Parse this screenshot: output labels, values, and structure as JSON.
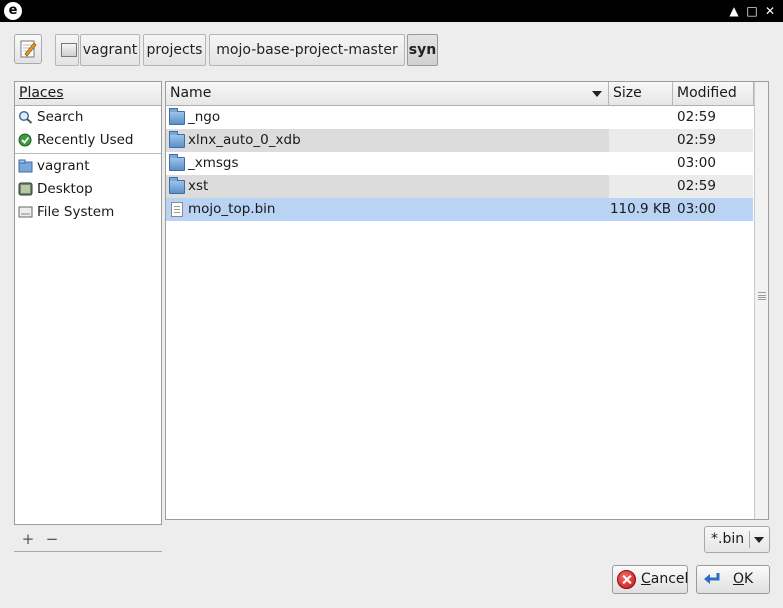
{
  "titlebar": {
    "app_icon": "e",
    "controls": {
      "up": "▲",
      "maximize": "□",
      "close": "✕"
    }
  },
  "path": {
    "segments": [
      "vagrant",
      "projects",
      "mojo-base-project-master",
      "syn"
    ]
  },
  "places": {
    "header": "Places",
    "items": [
      {
        "label": "Search",
        "icon": "search-icon"
      },
      {
        "label": "Recently Used",
        "icon": "recent-icon"
      },
      {
        "label": "vagrant",
        "icon": "home-folder-icon"
      },
      {
        "label": "Desktop",
        "icon": "desktop-icon"
      },
      {
        "label": "File System",
        "icon": "drive-icon"
      }
    ],
    "add": "+",
    "remove": "−"
  },
  "files": {
    "columns": {
      "name": "Name",
      "size": "Size",
      "modified": "Modified"
    },
    "rows": [
      {
        "name": "_ngo",
        "size": "",
        "modified": "02:59",
        "type": "folder"
      },
      {
        "name": "xlnx_auto_0_xdb",
        "size": "",
        "modified": "02:59",
        "type": "folder"
      },
      {
        "name": "_xmsgs",
        "size": "",
        "modified": "03:00",
        "type": "folder"
      },
      {
        "name": "xst",
        "size": "",
        "modified": "02:59",
        "type": "folder"
      },
      {
        "name": "mojo_top.bin",
        "size": "110.9 KB",
        "modified": "03:00",
        "type": "file"
      }
    ]
  },
  "filter": {
    "value": "*.bin"
  },
  "buttons": {
    "cancel": "Cancel",
    "ok": "OK"
  },
  "colors": {
    "selection": "#b8d3f3",
    "titlebar": "#000000",
    "folder": "#5d90c9",
    "cancel_icon": "#c81414"
  }
}
